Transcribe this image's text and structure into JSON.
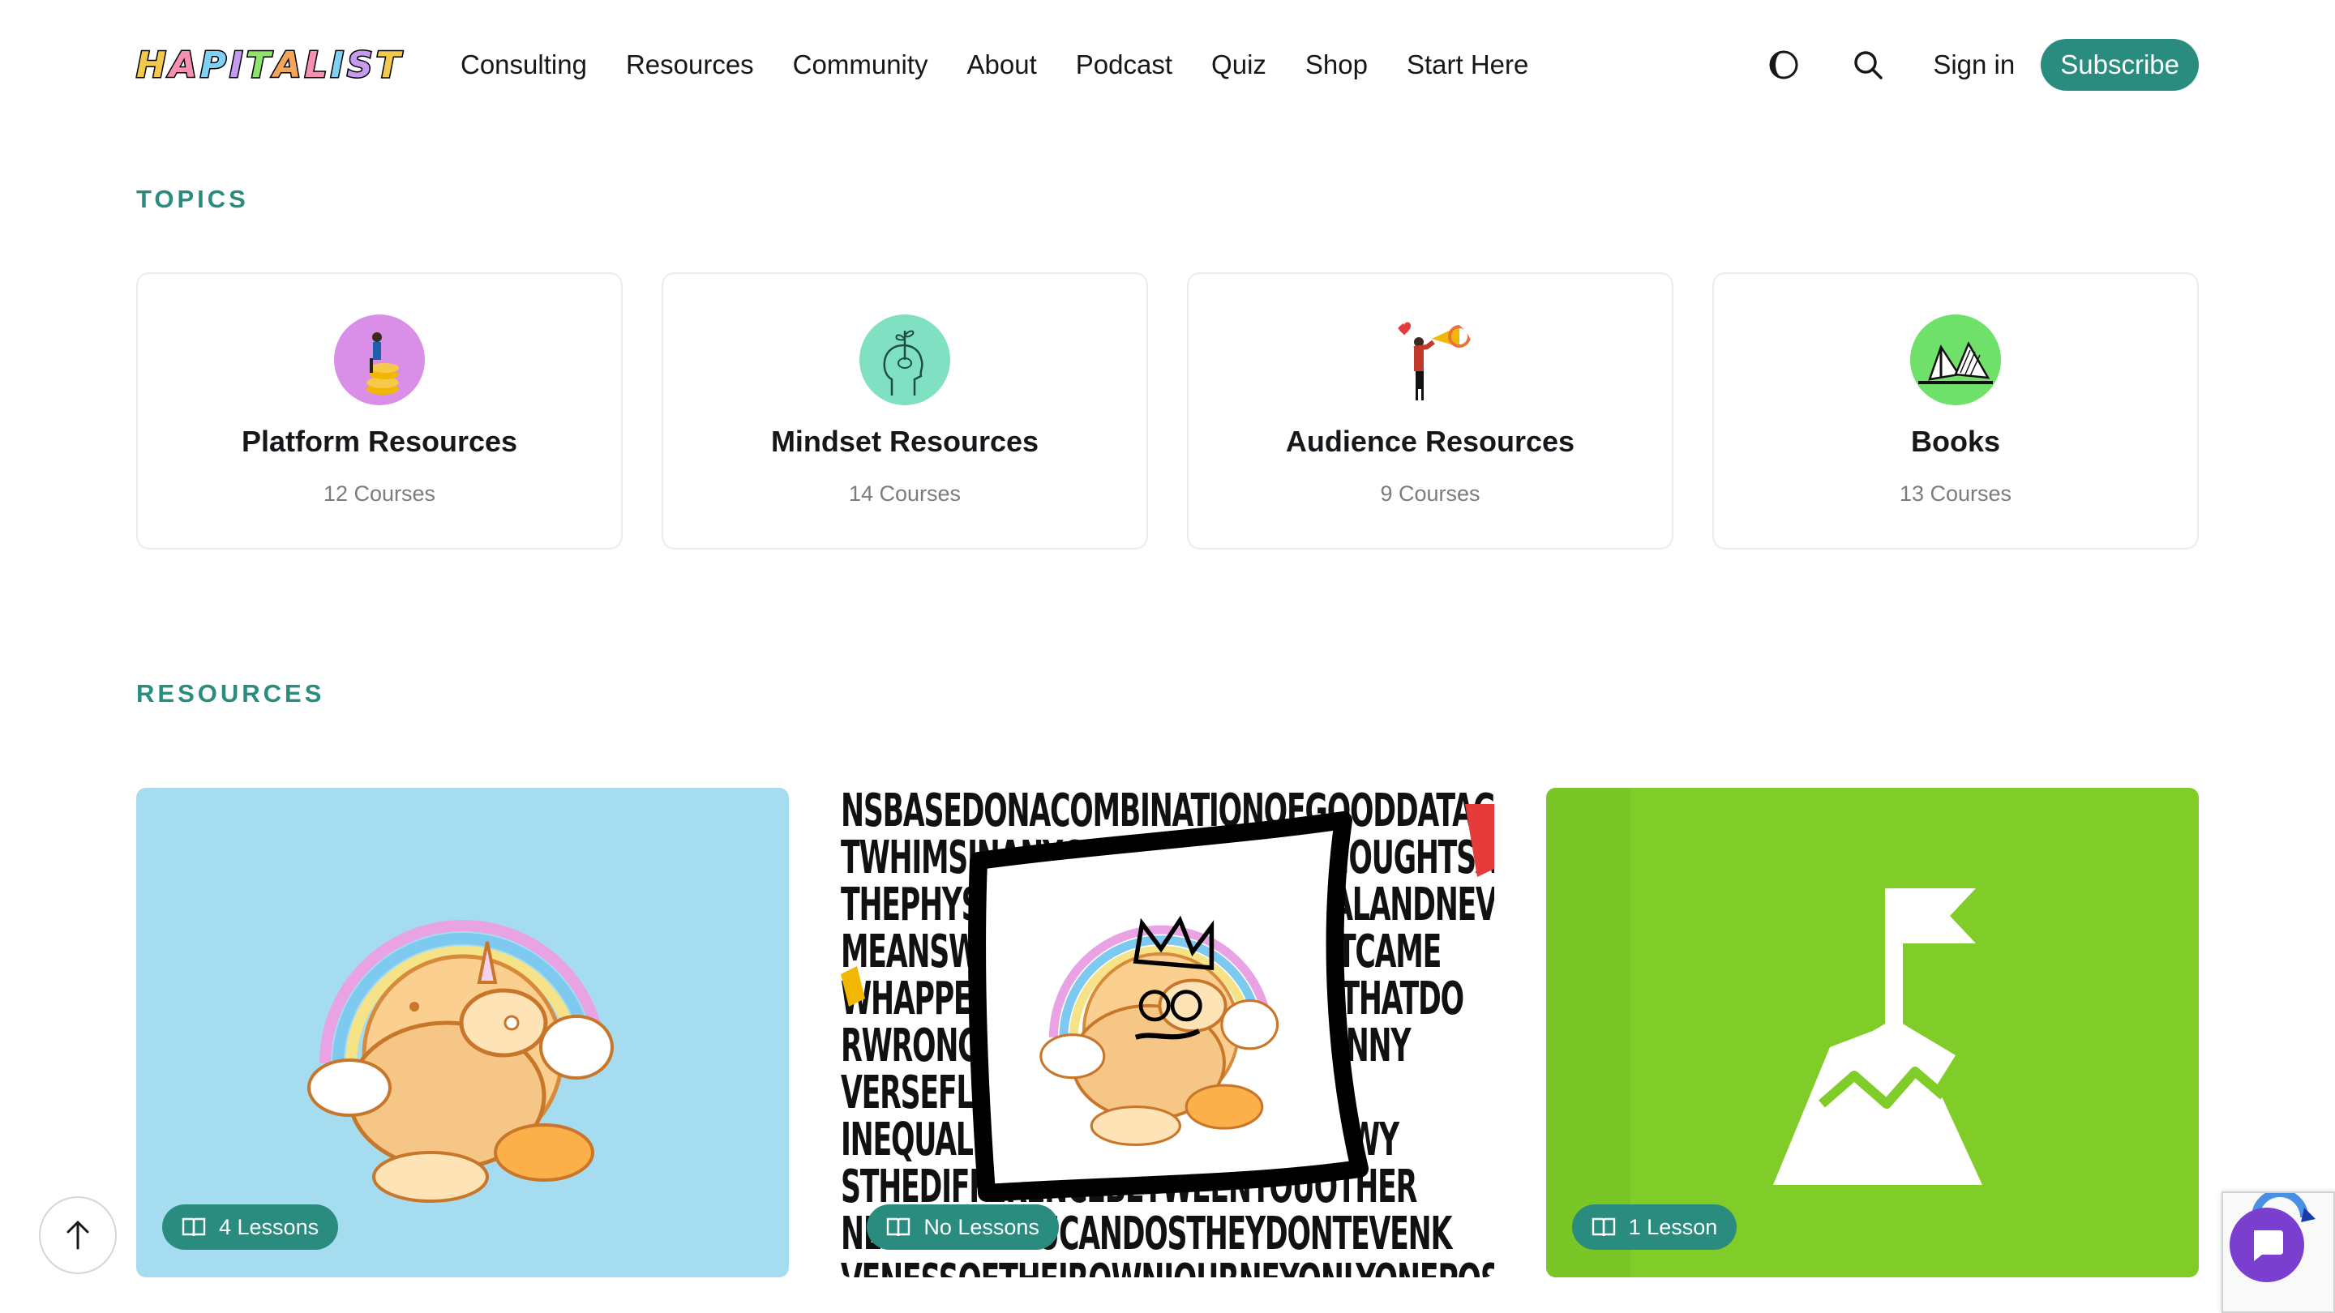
{
  "brand": {
    "logo_text": "HAPITALIST",
    "accent_color": "#2a8c7f"
  },
  "nav": {
    "items": [
      {
        "label": "Consulting"
      },
      {
        "label": "Resources"
      },
      {
        "label": "Community"
      },
      {
        "label": "About"
      },
      {
        "label": "Podcast"
      },
      {
        "label": "Quiz"
      },
      {
        "label": "Shop"
      },
      {
        "label": "Start Here"
      }
    ],
    "theme_toggle_icon": "moon-icon",
    "search_icon": "search-icon",
    "signin_label": "Sign in",
    "subscribe_label": "Subscribe"
  },
  "topics": {
    "heading": "TOPICS",
    "cards": [
      {
        "title": "Platform Resources",
        "count": "12 Courses",
        "icon": "coins-person-icon",
        "icon_bg": "#d98ee8"
      },
      {
        "title": "Mindset Resources",
        "count": "14 Courses",
        "icon": "head-sprout-icon",
        "icon_bg": "#7fe0c2"
      },
      {
        "title": "Audience Resources",
        "count": "9 Courses",
        "icon": "megaphone-person-icon",
        "icon_bg": "#ffffff"
      },
      {
        "title": "Books",
        "count": "13 Courses",
        "icon": "book-icon",
        "icon_bg": "#6fe06a"
      }
    ]
  },
  "resources": {
    "heading": "RESOURCES",
    "cards": [
      {
        "lessons": "4 Lessons",
        "image": "unicorn-rainbow-illustration",
        "bg": "#a6dcef"
      },
      {
        "lessons": "No Lessons",
        "image": "framed-unicorn-word-wall-illustration",
        "bg": "#ffffff"
      },
      {
        "lessons": "1 Lesson",
        "image": "mountain-flag-icon",
        "bg": "#80cc28"
      }
    ]
  },
  "floating": {
    "scroll_top_icon": "arrow-up-icon",
    "chat_icon": "chat-bubble-icon"
  }
}
